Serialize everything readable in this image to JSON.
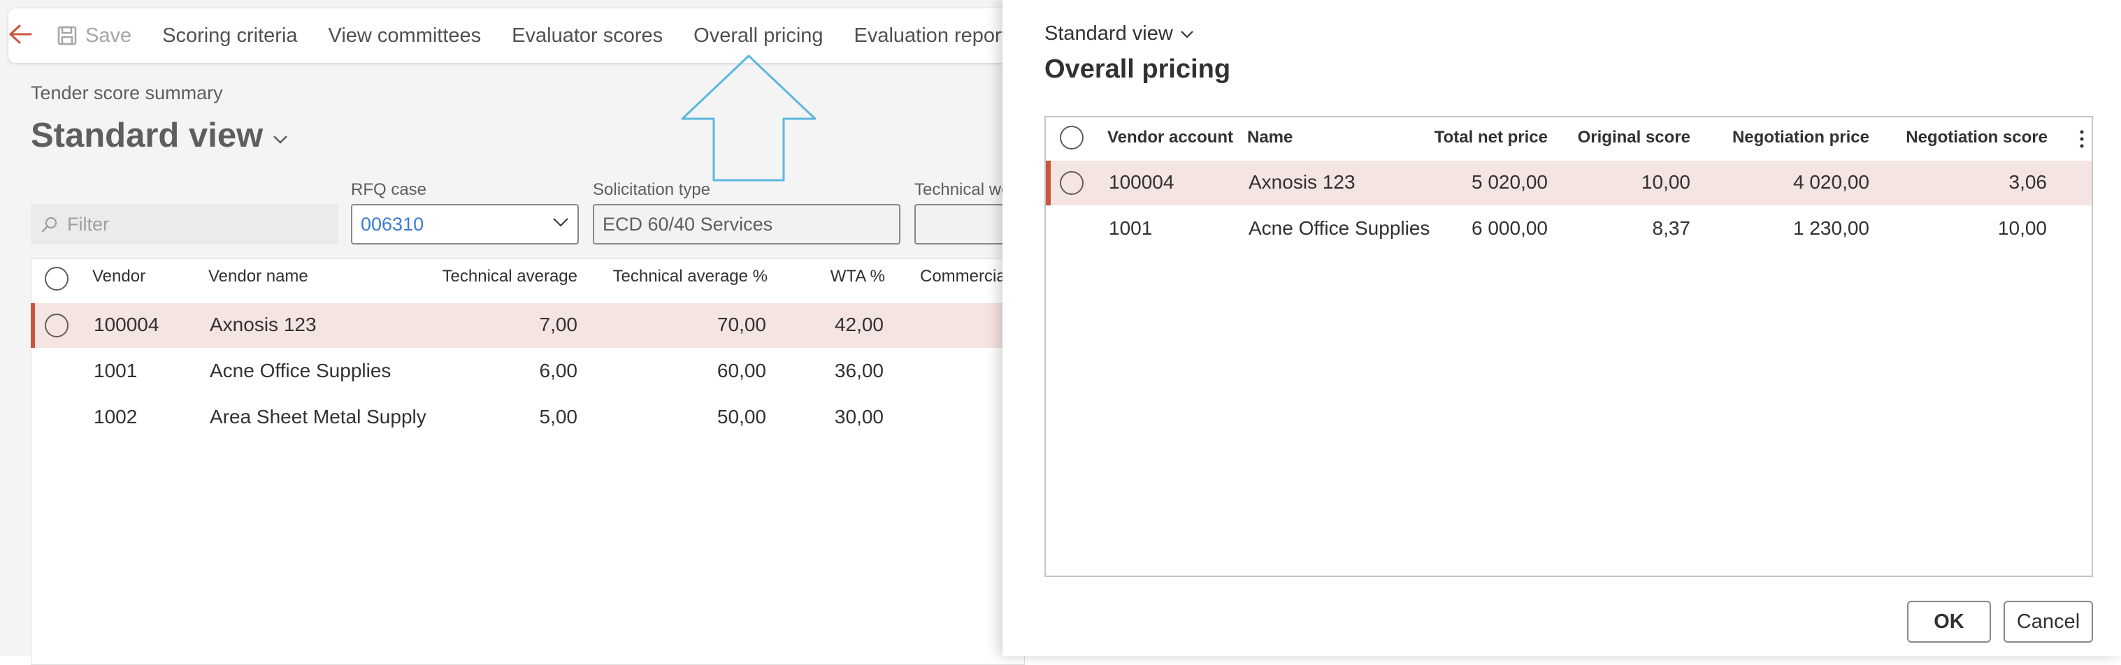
{
  "toolbar": {
    "save": "Save",
    "items": [
      "Scoring criteria",
      "View committees",
      "Evaluator scores",
      "Overall pricing",
      "Evaluation report"
    ]
  },
  "page": {
    "subtitle": "Tender score summary",
    "view": "Standard view"
  },
  "filter": {
    "placeholder": "Filter"
  },
  "fields": {
    "rfq_label": "RFQ case",
    "rfq_value": "006310",
    "solicitation_label": "Solicitation type",
    "solicitation_value": "ECD 60/40 Services",
    "technical_label": "Technical we"
  },
  "score_grid": {
    "headers": [
      "Vendor",
      "Vendor name",
      "Technical average",
      "Technical average %",
      "WTA %",
      "Commercia"
    ],
    "rows": [
      [
        "100004",
        "Axnosis 123",
        "7,00",
        "70,00",
        "42,00"
      ],
      [
        "1001",
        "Acne Office Supplies",
        "6,00",
        "60,00",
        "36,00"
      ],
      [
        "1002",
        "Area Sheet Metal Supply",
        "5,00",
        "50,00",
        "30,00"
      ]
    ]
  },
  "dialog": {
    "view": "Standard view",
    "title": "Overall pricing",
    "headers": [
      "Vendor account",
      "Name",
      "Total net price",
      "Original score",
      "Negotiation price",
      "Negotiation score"
    ],
    "rows": [
      [
        "100004",
        "Axnosis 123",
        "5 020,00",
        "10,00",
        "4 020,00",
        "3,06"
      ],
      [
        "1001",
        "Acne Office Supplies",
        "6 000,00",
        "8,37",
        "1 230,00",
        "10,00"
      ]
    ],
    "ok": "OK",
    "cancel": "Cancel"
  },
  "colors": {
    "accent_selection": "#c8553d",
    "selected_row_bg": "#f4e4e2",
    "callout_arrow": "#5bb8e0",
    "link_value": "#3a7bd5"
  }
}
